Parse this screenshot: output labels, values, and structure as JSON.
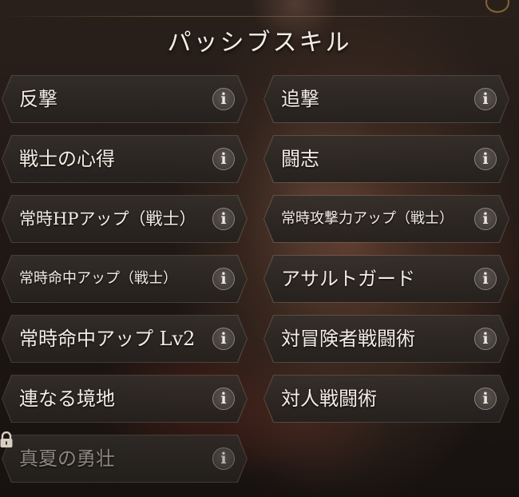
{
  "header": {
    "title": "パッシブスキル"
  },
  "skills": [
    {
      "label": "反撃",
      "info": "i"
    },
    {
      "label": "追撃",
      "info": "i"
    },
    {
      "label": "戦士の心得",
      "info": "i"
    },
    {
      "label": "闘志",
      "info": "i"
    },
    {
      "label": "常時HPアップ（戦士）",
      "info": "i"
    },
    {
      "label": "常時攻撃力アップ（戦士）",
      "info": "i"
    },
    {
      "label": "常時命中アップ（戦士）",
      "info": "i"
    },
    {
      "label": "アサルトガード",
      "info": "i"
    },
    {
      "label": "常時命中アップ Lv2",
      "info": "i"
    },
    {
      "label": "対冒険者戦闘術",
      "info": "i"
    },
    {
      "label": "連なる境地",
      "info": "i"
    },
    {
      "label": "対人戦闘術",
      "info": "i"
    },
    {
      "label": "真夏の勇壮",
      "info": "i",
      "locked": true
    }
  ],
  "icons": {
    "info": "info-icon",
    "lock": "lock-icon"
  },
  "colors": {
    "text": "#f3ede4",
    "locked_text": "#8e8782",
    "accent": "#cda046"
  }
}
